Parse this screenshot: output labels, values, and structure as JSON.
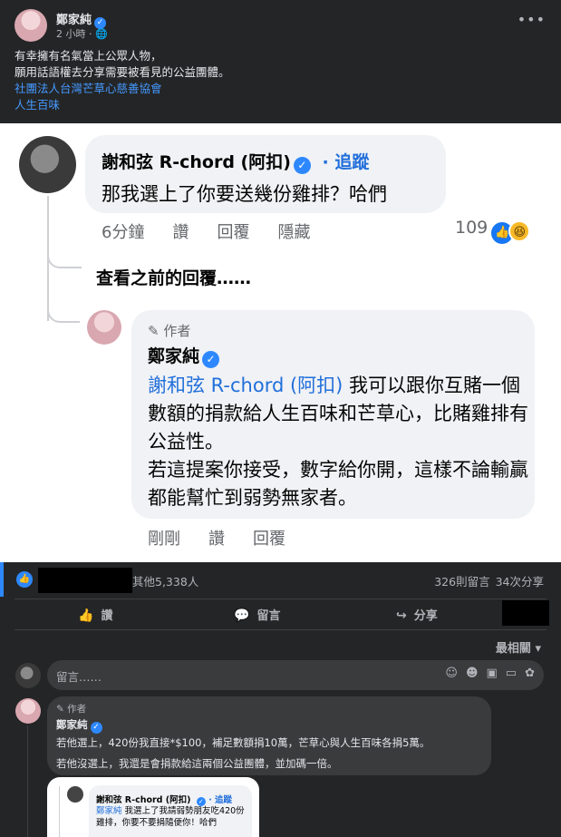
{
  "post": {
    "author": "鄭家純",
    "time": "2 小時",
    "privacy_icon": "globe-icon",
    "lines": [
      "有幸擁有名氣當上公眾人物，",
      "願用話語權去分享需要被看見的公益團體。"
    ],
    "links": [
      "社團法人台灣芒草心慈善協會",
      "人生百味"
    ]
  },
  "screenshot": {
    "comment1": {
      "name": "謝和弦 R-chord (阿扣)",
      "follow": "追蹤",
      "text": "那我選上了你要送幾份雞排？哈們",
      "time": "6分鐘",
      "like": "讚",
      "reply": "回覆",
      "hide": "隱藏",
      "reactions": "109"
    },
    "view_previous": "查看之前的回覆……",
    "reply": {
      "badge": "作者",
      "name": "鄭家純",
      "mention": "謝和弦 R-chord (阿扣)",
      "text_first": " 我可以跟你互賭一個數額的捐款給人生百味和芒草心，比賭雞排有公益性。",
      "text_second": "若這提案你接受，數字給你開，這樣不論輸贏都能幫忙到弱勢無家者。",
      "time": "剛剛",
      "like": "讚",
      "reply": "回覆"
    }
  },
  "stats": {
    "others": "其他5,338人",
    "comments": "326則留言",
    "shares": "34次分享"
  },
  "actions": {
    "like": "讚",
    "comment": "留言",
    "share": "分享"
  },
  "sort_label": "最相關",
  "comment_box": {
    "placeholder": "留言……"
  },
  "top_reply": {
    "badge": "作者",
    "name": "鄭家純",
    "line1": "若他選上，420份我直接*$100，補足數額捐10萬，芒草心與人生百味各捐5萬。",
    "line2": "若他沒選上，我還是會捐款給這兩個公益團體，並加碼一倍。"
  },
  "attachment": {
    "name": "謝和弦 R-chord (阿扣)",
    "follow": "追蹤",
    "mention": "鄭家純",
    "text": " 我選上了我請弱勢朋友吃420份雞排，你要不要捐隨便你！哈們"
  },
  "colors": {
    "background": "#242526",
    "link": "#4599ff",
    "verified": "#2d88ff"
  }
}
